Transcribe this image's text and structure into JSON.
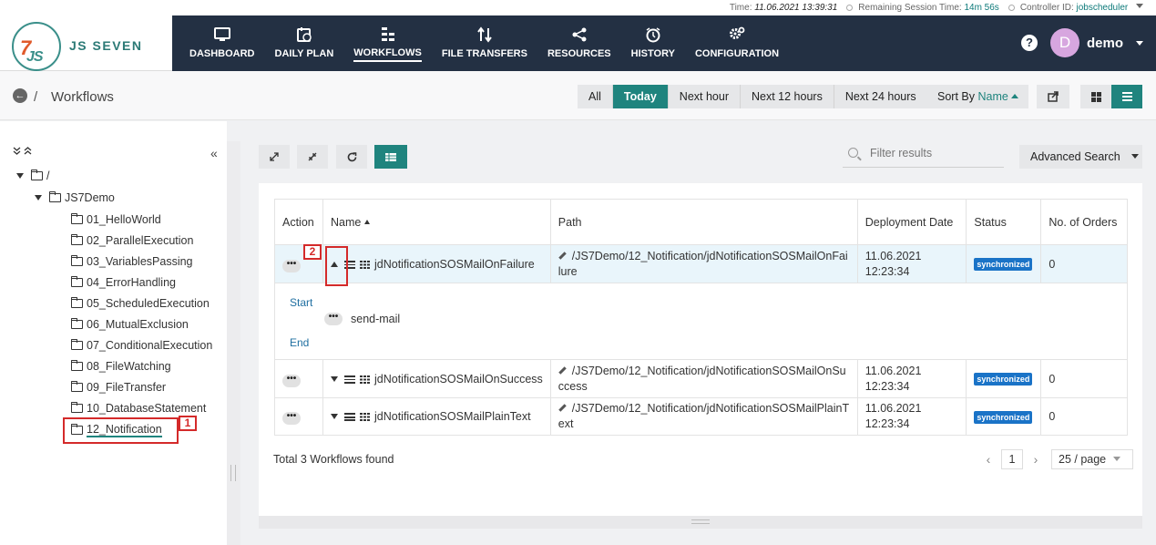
{
  "topstrip": {
    "time_label": "Time:",
    "time_value": "11.06.2021 13:39:31",
    "session_label": "Remaining Session Time:",
    "session_value": "14m 56s",
    "controller_label": "Controller ID:",
    "controller_value": "jobscheduler"
  },
  "logo": {
    "mark": "JS",
    "mark7": "7",
    "text": "JS SEVEN"
  },
  "nav": {
    "items": [
      {
        "label": "DASHBOARD",
        "icon": "monitor-icon"
      },
      {
        "label": "DAILY PLAN",
        "icon": "calendar-clock-icon"
      },
      {
        "label": "WORKFLOWS",
        "icon": "workflow-icon"
      },
      {
        "label": "FILE TRANSFERS",
        "icon": "transfer-arrows-icon"
      },
      {
        "label": "RESOURCES",
        "icon": "share-icon"
      },
      {
        "label": "HISTORY",
        "icon": "alarm-clock-icon"
      },
      {
        "label": "CONFIGURATION",
        "icon": "gears-icon"
      }
    ],
    "active": "WORKFLOWS",
    "help": "?",
    "avatar_letter": "D",
    "user": "demo"
  },
  "subheader": {
    "crumb_sep": "/",
    "title": "Workflows",
    "filters": [
      "All",
      "Today",
      "Next hour",
      "Next 12 hours",
      "Next 24 hours"
    ],
    "active_filter": "Today",
    "sort_label": "Sort By",
    "sort_value": "Name"
  },
  "tree": {
    "root": "/",
    "folder": "JS7Demo",
    "children": [
      "01_HelloWorld",
      "02_ParallelExecution",
      "03_VariablesPassing",
      "04_ErrorHandling",
      "05_ScheduledExecution",
      "06_MutualExclusion",
      "07_ConditionalExecution",
      "08_FileWatching",
      "09_FileTransfer",
      "10_DatabaseStatement",
      "12_Notification"
    ],
    "selected": "12_Notification",
    "callout_1": "1"
  },
  "toolbar": {
    "search_placeholder": "Filter results",
    "advanced_search": "Advanced Search"
  },
  "table": {
    "headers": {
      "action": "Action",
      "name": "Name",
      "path": "Path",
      "deployment": "Deployment Date",
      "status": "Status",
      "orders": "No. of Orders"
    },
    "rows": [
      {
        "name": "jdNotificationSOSMailOnFailure",
        "path": "/JS7Demo/12_Notification/jdNotificationSOSMailOnFailure",
        "date": "11.06.2021",
        "time": "12:23:34",
        "status": "synchronized",
        "orders": "0"
      },
      {
        "name": "jdNotificationSOSMailOnSuccess",
        "path": "/JS7Demo/12_Notification/jdNotificationSOSMailOnSuccess",
        "date": "11.06.2021",
        "time": "12:23:34",
        "status": "synchronized",
        "orders": "0"
      },
      {
        "name": "jdNotificationSOSMailPlainText",
        "path": "/JS7Demo/12_Notification/jdNotificationSOSMailPlainText",
        "date": "11.06.2021",
        "time": "12:23:34",
        "status": "synchronized",
        "orders": "0"
      }
    ],
    "detail": {
      "start": "Start",
      "job": "send-mail",
      "end": "End"
    },
    "callout_2": "2"
  },
  "pager": {
    "info": "Total 3 Workflows found",
    "page": "1",
    "size": "25 / page"
  },
  "colors": {
    "accent": "#1f847e",
    "nav_bg": "#233043",
    "badge": "#1a73c7",
    "callout": "#d42a2a"
  }
}
